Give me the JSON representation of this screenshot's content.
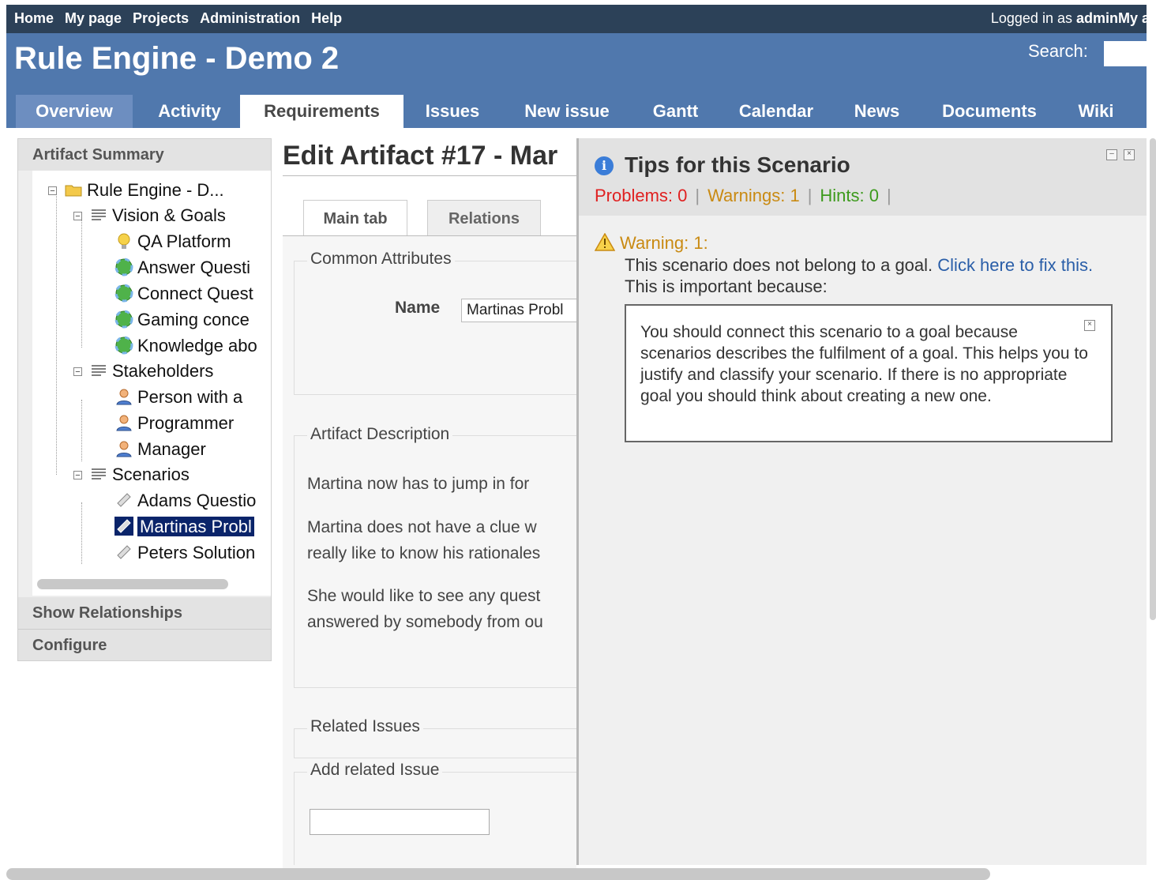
{
  "topmenu": {
    "items": [
      "Home",
      "My page",
      "Projects",
      "Administration",
      "Help"
    ],
    "logged_in_prefix": "Logged in as",
    "user": "admin",
    "my_account": "My a"
  },
  "header": {
    "project_title": "Rule Engine - Demo 2",
    "search_label": "Search:",
    "search_value": ""
  },
  "tabs": [
    "Overview",
    "Activity",
    "Requirements",
    "Issues",
    "New issue",
    "Gantt",
    "Calendar",
    "News",
    "Documents",
    "Wiki"
  ],
  "selected_tab": "Requirements",
  "sidebar": {
    "artifact_summary": "Artifact Summary",
    "show_relationships": "Show Relationships",
    "configure": "Configure",
    "tree": {
      "root": "Rule Engine - D...",
      "vision_goals": "Vision & Goals",
      "goals": [
        "QA Platform",
        "Answer Questi",
        "Connect Quest",
        "Gaming conce",
        "Knowledge abo"
      ],
      "stakeholders": "Stakeholders",
      "people": [
        "Person with a",
        "Programmer",
        "Manager"
      ],
      "scenarios": "Scenarios",
      "scenario_items": [
        "Adams Questio",
        "Martinas Probl",
        "Peters Solution"
      ]
    }
  },
  "main": {
    "title": "Edit Artifact #17 - Mar",
    "tab_main": "Main tab",
    "tab_relations": "Relations",
    "common_attributes": "Common Attributes",
    "name_label": "Name",
    "name_value": "Martinas Probl",
    "artifact_description": "Artifact Description",
    "desc_lines": [
      "Martina now has to jump in for",
      "Martina does not have a clue w",
      "really like to know his rationales",
      "She would like to see any quest",
      "answered by somebody from ou"
    ],
    "related_issues": "Related Issues",
    "add_related_issue": "Add related Issue",
    "related_issue_value": ""
  },
  "tips": {
    "title": "Tips for this Scenario",
    "problems": "Problems: 0",
    "warnings": "Warnings: 1",
    "hints": "Hints: 0",
    "warning_heading": "Warning: 1:",
    "warning_text": "This scenario does not belong to a goal.",
    "fix_link": "Click here to fix this.",
    "warning_suffix": "This is important because:",
    "box_text": "You should connect this scenario to a goal because scenarios describes the fulfilment of a goal. This helps you to justify and classify your scenario. If there is no appropriate goal you should think about creating a new one.",
    "colors": {
      "problems": "#e02020",
      "warnings": "#c98a12",
      "hints": "#3c9a1c"
    }
  }
}
